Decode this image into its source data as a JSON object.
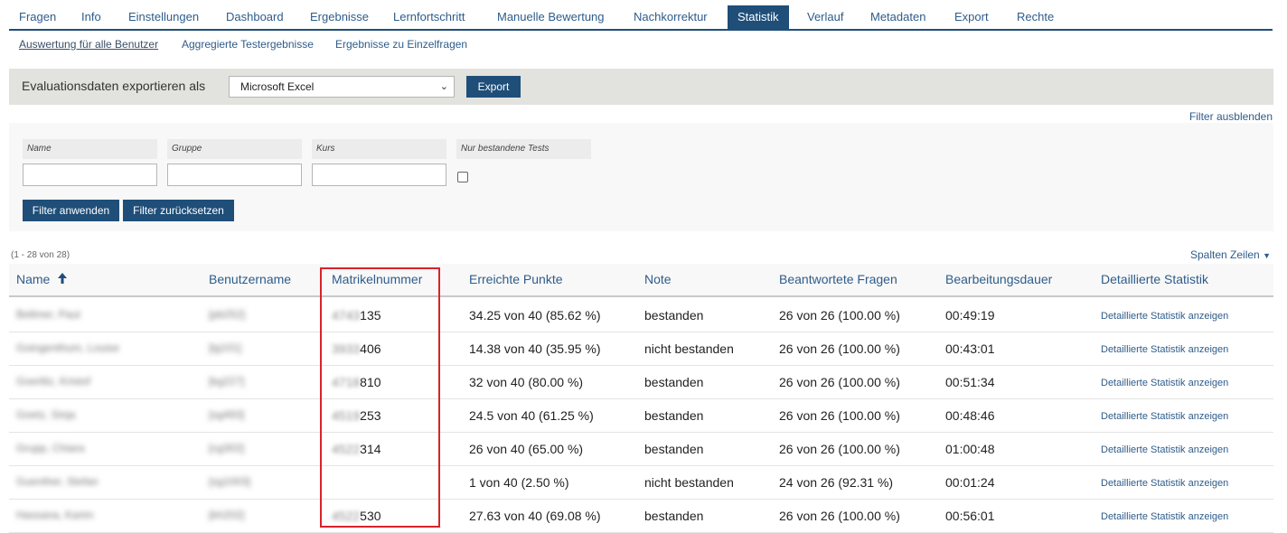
{
  "tabs": [
    {
      "label": "Fragen"
    },
    {
      "label": "Info"
    },
    {
      "label": "Einstellungen"
    },
    {
      "label": "Dashboard"
    },
    {
      "label": "Ergebnisse"
    },
    {
      "label": "Lernfortschritt"
    },
    {
      "label": "Manuelle Bewertung"
    },
    {
      "label": "Nachkorrektur"
    },
    {
      "label": "Statistik"
    },
    {
      "label": "Verlauf"
    },
    {
      "label": "Metadaten"
    },
    {
      "label": "Export"
    },
    {
      "label": "Rechte"
    }
  ],
  "subtabs": [
    {
      "label": "Auswertung für alle Benutzer"
    },
    {
      "label": "Aggregierte Testergebnisse"
    },
    {
      "label": "Ergebnisse zu Einzelfragen"
    }
  ],
  "export": {
    "label": "Evaluationsdaten exportieren als",
    "selected": "Microsoft Excel",
    "button": "Export"
  },
  "filter": {
    "hide_label": "Filter ausblenden",
    "fields": [
      "Name",
      "Gruppe",
      "Kurs",
      "Nur bestandene Tests"
    ],
    "apply": "Filter anwenden",
    "reset": "Filter zurücksetzen"
  },
  "table": {
    "count": "(1 - 28 von 28)",
    "columns_label": "Spalten",
    "rows_label": "Zeilen",
    "headers": [
      "Name",
      "Benutzername",
      "Matrikelnummer",
      "Erreichte Punkte",
      "Note",
      "Beantwortete Fragen",
      "Bearbeitungsdauer",
      "Detaillierte Statistik"
    ],
    "rows": [
      {
        "name": "Bellmer, Paul",
        "user": "[pb252]",
        "mat_pre": "4743",
        "mat": "135",
        "points": "34.25 von 40 (85.62 %)",
        "grade": "bestanden",
        "answered": "26 von 26 (100.00 %)",
        "duration": "00:49:19",
        "link": "Detaillierte Statistik anzeigen"
      },
      {
        "name": "Goingenthum, Louise",
        "user": "[lg101]",
        "mat_pre": "3933",
        "mat": "406",
        "points": "14.38 von 40 (35.95 %)",
        "grade": "nicht bestanden",
        "answered": "26 von 26 (100.00 %)",
        "duration": "00:43:01",
        "link": "Detaillierte Statistik anzeigen"
      },
      {
        "name": "Goerlitz, Kristof",
        "user": "[kg227]",
        "mat_pre": "4718",
        "mat": "810",
        "points": "32 von 40 (80.00 %)",
        "grade": "bestanden",
        "answered": "26 von 26 (100.00 %)",
        "duration": "00:51:34",
        "link": "Detaillierte Statistik anzeigen"
      },
      {
        "name": "Goetz, Sinja",
        "user": "[sg493]",
        "mat_pre": "4519",
        "mat": "253",
        "points": "24.5 von 40 (61.25 %)",
        "grade": "bestanden",
        "answered": "26 von 26 (100.00 %)",
        "duration": "00:48:46",
        "link": "Detaillierte Statistik anzeigen"
      },
      {
        "name": "Grupp, Chiara",
        "user": "[cg302]",
        "mat_pre": "4522",
        "mat": "314",
        "points": "26 von 40 (65.00 %)",
        "grade": "bestanden",
        "answered": "26 von 26 (100.00 %)",
        "duration": "01:00:48",
        "link": "Detaillierte Statistik anzeigen"
      },
      {
        "name": "Guenther, Stefan",
        "user": "[sg1003]",
        "mat_pre": "",
        "mat": "",
        "points": "1 von 40 (2.50 %)",
        "grade": "nicht bestanden",
        "answered": "24 von 26 (92.31 %)",
        "duration": "00:01:24",
        "link": "Detaillierte Statistik anzeigen"
      },
      {
        "name": "Hassana, Karim",
        "user": "[kh202]",
        "mat_pre": "4522",
        "mat": "530",
        "points": "27.63 von 40 (69.08 %)",
        "grade": "bestanden",
        "answered": "26 von 26 (100.00 %)",
        "duration": "00:56:01",
        "link": "Detaillierte Statistik anzeigen"
      }
    ]
  },
  "colors": {
    "accent": "#1f4e79",
    "link": "#2e5c8a",
    "highlight": "#d9232a"
  },
  "icons": {
    "sort": "arrow-up-icon",
    "select": "chevron-down-icon",
    "menu": "caret-down-icon"
  }
}
